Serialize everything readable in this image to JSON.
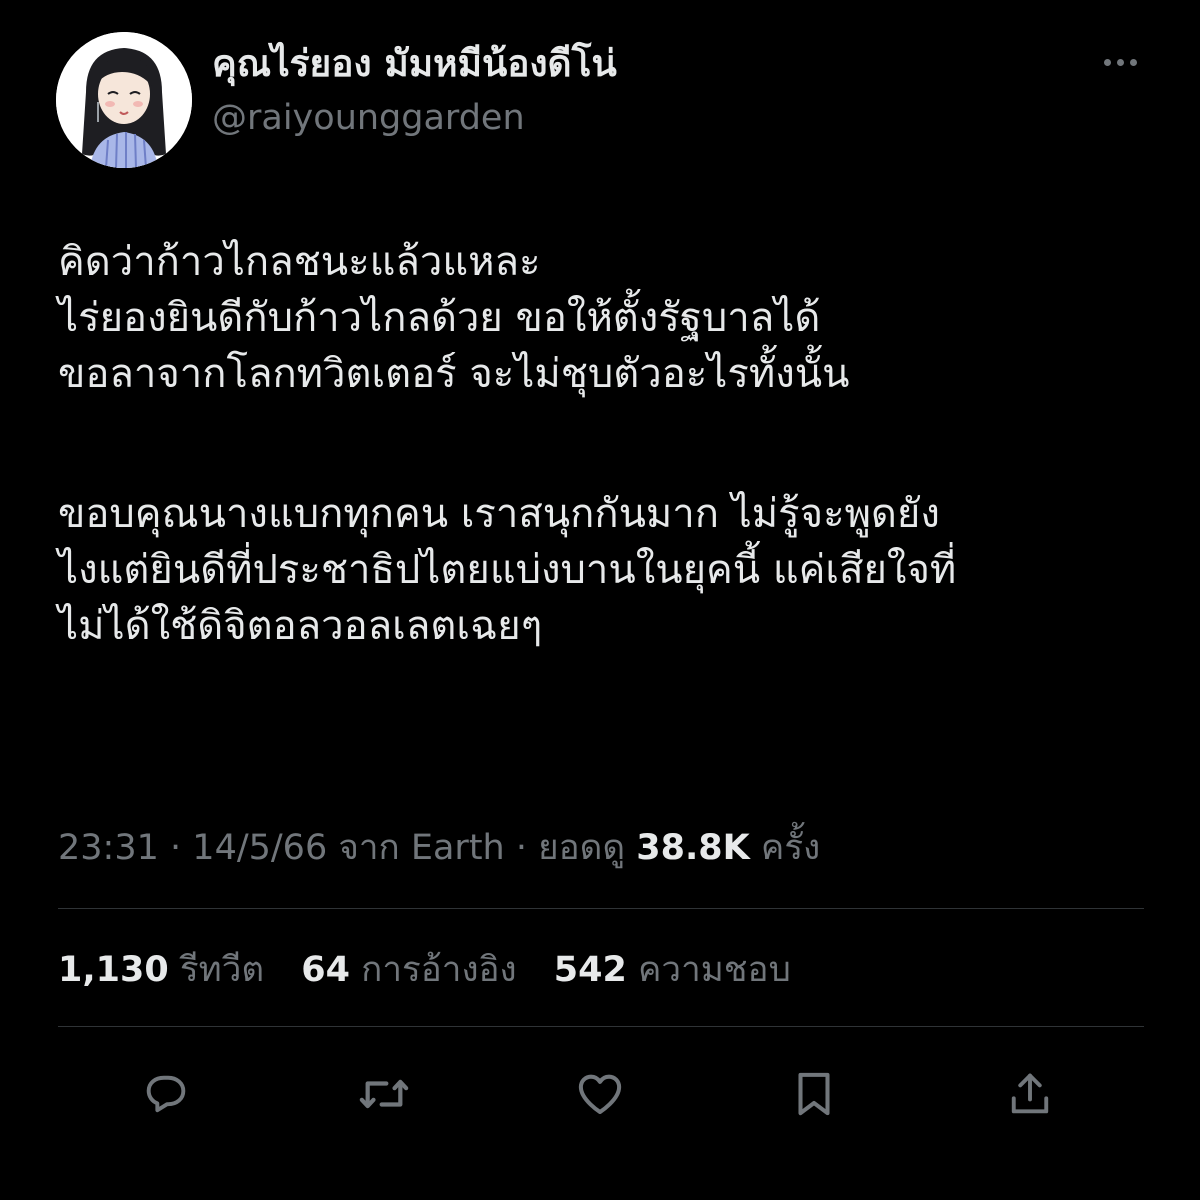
{
  "author": {
    "display_name": "คุณไร่ยอง มัมหมีน้องดีโน่",
    "handle": "@raiyounggarden"
  },
  "tweet": {
    "lines": [
      "คิดว่าก้าวไกลชนะแล้วแหละ",
      "ไร่ยองยินดีกับก้าวไกลด้วย ขอให้ตั้งรัฐบาลได้",
      "ขอลาจากโลกทวิตเตอร์ จะไม่ชุบตัวอะไรทั้งนั้น",
      "",
      "ขอบคุณนางแบกทุกคน เราสนุกกันมาก ไม่รู้จะพูดยัง",
      "ไงแต่ยินดีที่ประชาธิปไตยแบ่งบานในยุคนี้ แค่เสียใจที่",
      "ไม่ได้ใช้ดิจิตอลวอลเลตเฉยๆ"
    ]
  },
  "meta": {
    "time": "23:31",
    "separator": "·",
    "date": "14/5/66",
    "source_prefix": "จาก",
    "source": "Earth",
    "views_label": "ยอดดู",
    "views_count": "38.8K",
    "views_suffix": "ครั้ง"
  },
  "stats": {
    "retweets_count": "1,130",
    "retweets_label": "รีทวีต",
    "quotes_count": "64",
    "quotes_label": "การอ้างอิง",
    "likes_count": "542",
    "likes_label": "ความชอบ"
  },
  "actions": {
    "reply": "reply-icon",
    "retweet": "retweet-icon",
    "like": "heart-icon",
    "bookmark": "bookmark-icon",
    "share": "share-icon"
  },
  "colors": {
    "background": "#000000",
    "primary_text": "#e7e9ea",
    "secondary_text": "#71767b",
    "divider": "#2f3336"
  }
}
